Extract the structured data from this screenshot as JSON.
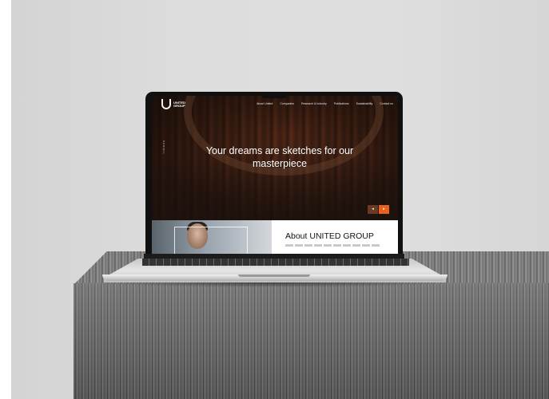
{
  "site": {
    "logo_text": "UNITED GROUP",
    "nav": [
      "About United",
      "Companies",
      "Research & Industry",
      "Publications",
      "Sustainability",
      "Contact us"
    ],
    "side_label": "SCROLL",
    "headline": "Your dreams are sketches for our masterpiece",
    "prev_arrow": "◂",
    "next_arrow": "▸",
    "about_title": "About UNITED GROUP"
  },
  "colors": {
    "accent": "#e8611d",
    "hero_dark": "#2b1b14",
    "backdrop": "#dcdcdc",
    "stone": "#6f6f6f"
  }
}
